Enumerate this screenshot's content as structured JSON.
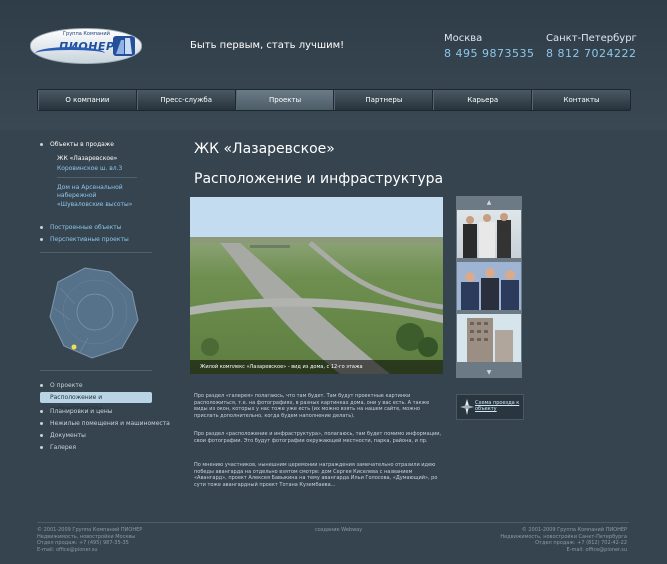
{
  "header": {
    "logo_top": "Группа Компаний",
    "logo_name": "ПИОНЕР",
    "slogan": "Быть первым, стать лучшим!",
    "cities": [
      {
        "name": "Москва",
        "phone": "8 495 9873535"
      },
      {
        "name": "Санкт-Петербург",
        "phone": "8 812 7024222"
      }
    ]
  },
  "nav": {
    "items": [
      "О компании",
      "Пресс-служба",
      "Проекты",
      "Партнеры",
      "Карьера",
      "Контакты"
    ],
    "active_index": 2
  },
  "sidebar": {
    "section_title": "Объекты в продаже",
    "current_objects": [
      "ЖК «Лазаревское»",
      "Коровинское ш. вл.3"
    ],
    "more_objects": [
      "Дом на Арсенальной набережной",
      "«Шуваловские высоты»"
    ],
    "other_links": [
      "Построенные объекты",
      "Перспективные проекты"
    ],
    "project_menu": [
      "О проекте",
      "Расположение и инфраструктура",
      "Планировки и цены",
      "Нежилые помещения и машиноместа",
      "Документы",
      "Галерея"
    ],
    "project_menu_active": 1
  },
  "main": {
    "title": "ЖК «Лазаревское»",
    "subtitle": "Расположение и инфраструктура",
    "photo_caption": "Жилой комплекс «Лазаревское» - вид из дома, с 12-го этажа",
    "paragraphs": [
      "Про раздел «галерея» полагаюсь, что там будет. Там будут проектные картинки расположиться, т.е. на фотографиях, в разных картинках дома, они у вас есть. А также виды из окон, которых у нас тоже уже есть (их можно взять на нашем сайте, можно прислать дополнительно, когда будем наполнение делать).",
      "Про раздел «расположение и инфраструктура», полагаюсь, там будет помимо информации, свои фотографии. Это будут фотографии окружающей местности, парка, района, и пр.",
      "По мнению участников, нынешним церемонии награждения замечательно отразили идею победы авангарда на отдельно взятом смотре: дом Сергея Киселева с названием «Авангард», проект Алексея Бавыкина на тему авангарда Ильи Голосова, «Думающий», ро сути тоже авангардный проект Тотана Кузембаева..."
    ],
    "scheme_link": "Схема проезда к объекту"
  },
  "footer": {
    "left": [
      "© 2001-2009 Группа Компаний ПИОНЕР",
      "Недвижимость, новостройки Москвы",
      "Отдел продаж: +7 (495) 987-35-35",
      "E-mail: office@pioner.su"
    ],
    "center": "создание Webway",
    "right": [
      "© 2001-2009 Группа Компаний ПИОНЕР",
      "Недвижимость, новостройки Санкт-Петербурга",
      "Отдел продаж: +7 (812) 702-42-22",
      "E-mail: office@pioner.su"
    ]
  },
  "colors": {
    "background": "#36444f",
    "accent": "#8fc6ec",
    "active_tab": "#b9d4e4"
  }
}
